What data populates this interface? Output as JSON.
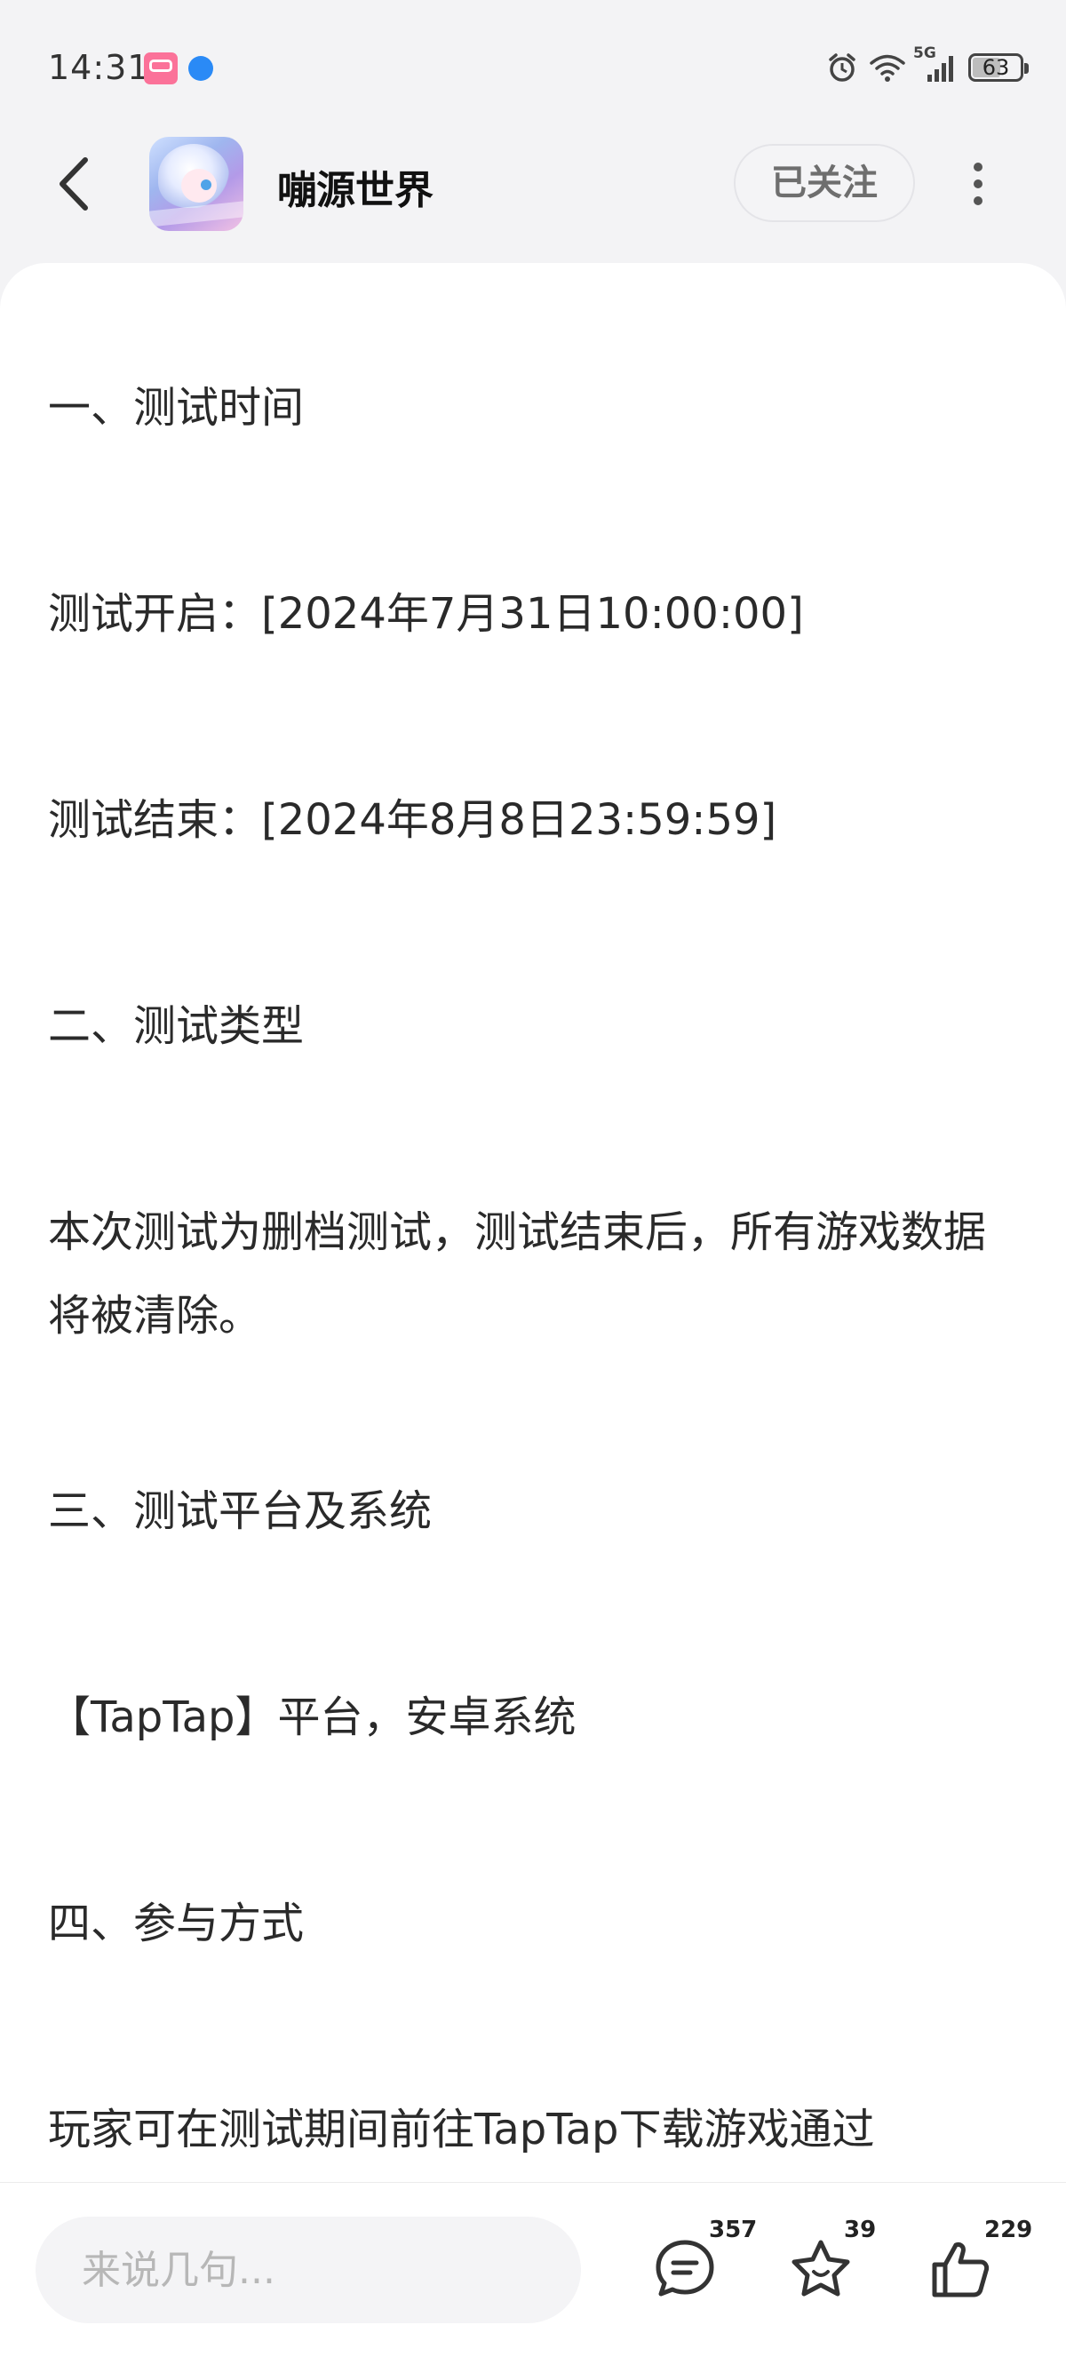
{
  "status_bar": {
    "time": "14:31",
    "network": "5G",
    "battery": "63",
    "battery_level": 0.63
  },
  "header": {
    "game_name": "嘣源世界",
    "follow_label": "已关注",
    "icons": [
      "back-arrow-icon",
      "more-vertical-icon"
    ]
  },
  "article": {
    "paragraphs": [
      "一、测试时间",
      "测试开启：[2024年7月31日10:00:00]",
      "测试结束：[2024年8月8日23:59:59]",
      "二、测试类型",
      "本次测试为删档测试，测试结束后，所有游戏数据将被清除。",
      "三、测试平台及系统",
      "【TapTap】平台，安卓系统",
      "四、参与方式",
      "玩家可在测试期间前往TapTap下载游戏通过"
    ]
  },
  "bottom_bar": {
    "comment_placeholder": "来说几句...",
    "comment_count": "357",
    "favorite_count": "39",
    "like_count": "229",
    "icons": [
      "comment-icon",
      "star-icon",
      "thumbs-up-icon"
    ]
  }
}
